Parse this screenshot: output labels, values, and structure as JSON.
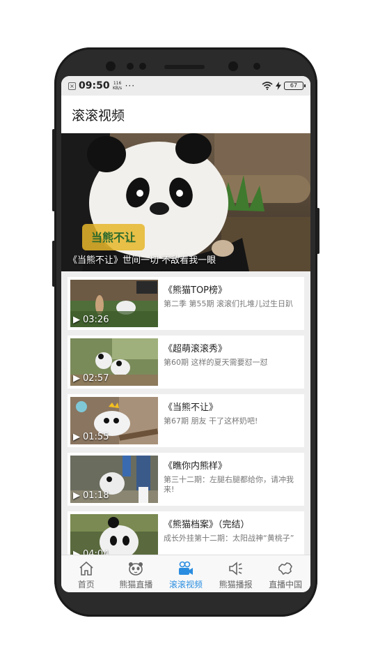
{
  "status_bar": {
    "time": "09:50",
    "speed": "116 KB/s",
    "dots": "···",
    "battery": "67"
  },
  "header": {
    "title": "滚滚视频"
  },
  "banner": {
    "caption": "《当熊不让》世间一切 不敌看我一眼"
  },
  "videos": [
    {
      "title": "《熊猫TOP榜》",
      "subtitle": "第二季 第55期 滚滚们扎堆儿过生日趴",
      "duration": "03:26"
    },
    {
      "title": "《超萌滚滚秀》",
      "subtitle": "第60期 这样的夏天需要怼一怼",
      "duration": "02:57"
    },
    {
      "title": "《当熊不让》",
      "subtitle": "第67期 朋友 干了这杯奶吧!",
      "duration": "01:55"
    },
    {
      "title": "《瞧你内熊样》",
      "subtitle": "第三十二期：左腿右腿都给你，请冲我来!",
      "duration": "01:18"
    },
    {
      "title": "《熊猫档案》（完结）",
      "subtitle": "成长外挂第十二期：太阳战神“黄桃子”",
      "duration": "04:04"
    }
  ],
  "tabs": [
    {
      "label": "首页",
      "icon": "home-icon"
    },
    {
      "label": "熊猫直播",
      "icon": "panda-face-icon"
    },
    {
      "label": "滚滚视频",
      "icon": "video-camera-icon",
      "active": true
    },
    {
      "label": "熊猫播报",
      "icon": "speaker-icon"
    },
    {
      "label": "直播中国",
      "icon": "china-map-icon"
    }
  ],
  "colors": {
    "accent": "#2a8de0"
  }
}
